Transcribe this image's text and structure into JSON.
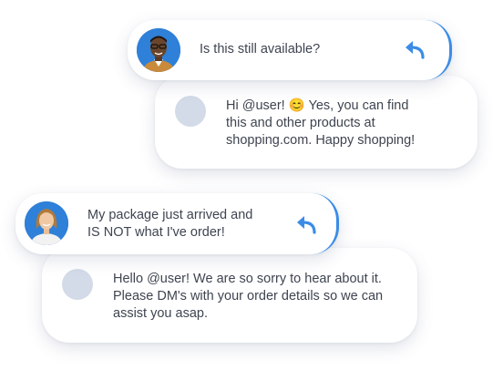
{
  "threads": [
    {
      "message": {
        "text": "Is this still available?",
        "avatar_icon": "man-avatar-icon"
      },
      "reply": {
        "text": "Hi @user! 😊 Yes, you can find\nthis and other products at\nshopping.com. Happy shopping!"
      }
    },
    {
      "message": {
        "text": "My package just arrived and\nIS NOT what I've order!",
        "avatar_icon": "woman-avatar-icon"
      },
      "reply": {
        "text": "Hello @user! We are so sorry to hear about it.\nPlease DM's with your order details so we can\nassist you asap."
      }
    }
  ],
  "colors": {
    "accent": "#3b8ce6",
    "placeholder_avatar": "#d3dbe8",
    "text": "#3e4450"
  }
}
